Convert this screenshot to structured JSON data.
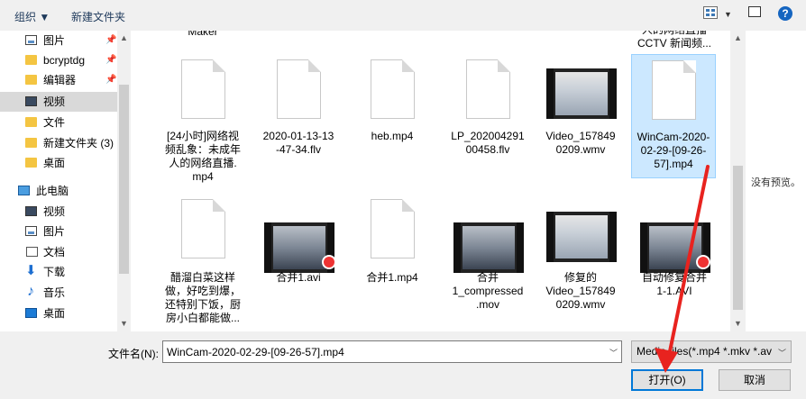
{
  "toolbar": {
    "organize": "组织 ▼",
    "new_folder": "新建文件夹",
    "help": "?"
  },
  "nav": {
    "items": [
      {
        "label": "图片",
        "icon": "picture-icon",
        "pinned": true
      },
      {
        "label": "bcryptdg",
        "icon": "folder-icon",
        "pinned": true
      },
      {
        "label": "编辑器",
        "icon": "folder-icon",
        "pinned": true
      },
      {
        "label": "视频",
        "icon": "video-icon",
        "selected": true
      },
      {
        "label": "文件",
        "icon": "folder-icon"
      },
      {
        "label": "新建文件夹 (3)",
        "icon": "folder-icon"
      },
      {
        "label": "桌面",
        "icon": "folder-icon"
      },
      {
        "label": "此电脑",
        "icon": "computer-icon"
      },
      {
        "label": "视频",
        "icon": "video-icon"
      },
      {
        "label": "图片",
        "icon": "picture-icon"
      },
      {
        "label": "文档",
        "icon": "document-icon"
      },
      {
        "label": "下载",
        "icon": "download-icon"
      },
      {
        "label": "音乐",
        "icon": "music-icon"
      },
      {
        "label": "桌面",
        "icon": "desktop-icon"
      }
    ]
  },
  "files": {
    "top_partial": [
      "Maker",
      "人的网络直播\nCCTV 新闻频..."
    ],
    "row1": [
      {
        "name": "[24小时]网络视\n频乱象：未成年\n人的网络直播.\nmp4",
        "type": "doc"
      },
      {
        "name": "2020-01-13-13\n-47-34.flv",
        "type": "doc"
      },
      {
        "name": "heb.mp4",
        "type": "doc"
      },
      {
        "name": "LP_202004291\n00458.flv",
        "type": "doc"
      },
      {
        "name": "Video_157849\n0209.wmv",
        "type": "video"
      },
      {
        "name": "WinCam-2020-\n02-29-[09-26-\n57].mp4",
        "type": "doc",
        "selected": true
      }
    ],
    "row2": [
      {
        "name": "醋溜白菜这样\n做，好吃到爆，\n还特别下饭，厨\n房小白都能做...",
        "type": "doc"
      },
      {
        "name": "合并1.avi",
        "type": "video"
      },
      {
        "name": "合并1.mp4",
        "type": "doc"
      },
      {
        "name": "合并\n1_compressed\n.mov",
        "type": "video"
      },
      {
        "name": "修复的\nVideo_157849\n0209.wmv",
        "type": "video"
      },
      {
        "name": "自动修复合并\n1-1.AVI",
        "type": "video"
      }
    ]
  },
  "preview": {
    "text": "没有预览。"
  },
  "bottom": {
    "filename_label": "文件名(N):",
    "filename_value": "WinCam-2020-02-29-[09-26-57].mp4",
    "filter": "Media files(*.mp4 *.mkv *.av",
    "open": "打开(O)",
    "cancel": "取消"
  },
  "colors": {
    "accent": "#0078d7",
    "annotation": "#e8231f",
    "selection": "#cce8ff"
  }
}
